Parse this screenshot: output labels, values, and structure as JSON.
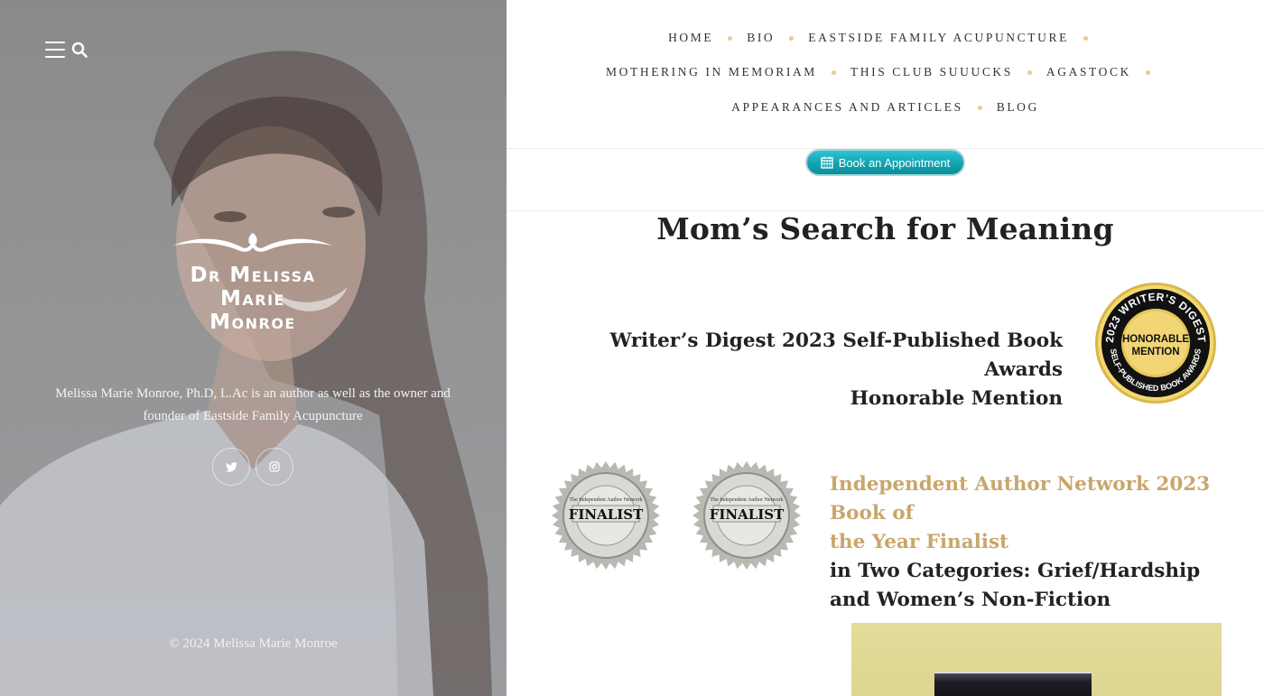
{
  "sidebar": {
    "logo_lines": [
      "Dr Melissa",
      "Marie",
      "Monroe"
    ],
    "bio": "Melissa Marie Monroe, Ph.D, L.Ac is an author as well as the owner and founder of Eastside Family Acupuncture",
    "social": [
      {
        "name": "twitter",
        "icon": "twitter-icon"
      },
      {
        "name": "instagram",
        "icon": "instagram-icon"
      }
    ],
    "copyright": "© 2024 Melissa Marie Monroe"
  },
  "nav": {
    "rows": [
      [
        "HOME",
        "BIO",
        "EASTSIDE FAMILY ACUPUNCTURE"
      ],
      [
        "MOTHERING IN MEMORIAM",
        "THIS CLUB SUUUCKS",
        "AGASTOCK"
      ],
      [
        "APPEARANCES AND ARTICLES",
        "BLOG"
      ]
    ]
  },
  "appointment": {
    "label": "Book an Appointment",
    "icon": "calendar-icon"
  },
  "page": {
    "title": "Mom’s Search for Meaning",
    "award_wd": {
      "line1": "Writer’s Digest 2023 Self-Published Book Awards",
      "line2": "Honorable Mention",
      "seal_top": "2023 WRITER’S DIGEST",
      "seal_mid1": "HONORABLE",
      "seal_mid2": "MENTION",
      "seal_bottom": "SELF-PUBLISHED BOOK AWARDS"
    },
    "award_ian": {
      "gold_line1": "Independent Author Network 2023 Book of",
      "gold_line2": "the Year Finalist",
      "dark_line1": "in Two Categories: Grief/Hardship",
      "dark_line2": "and Women’s Non-Fiction",
      "seal_text": "FINALIST",
      "seal_small": "The Independent Author Network"
    }
  },
  "colors": {
    "accent_gold": "#c9a66b",
    "nav_dot": "#e8c99a",
    "button_teal": "#12a3b1"
  }
}
